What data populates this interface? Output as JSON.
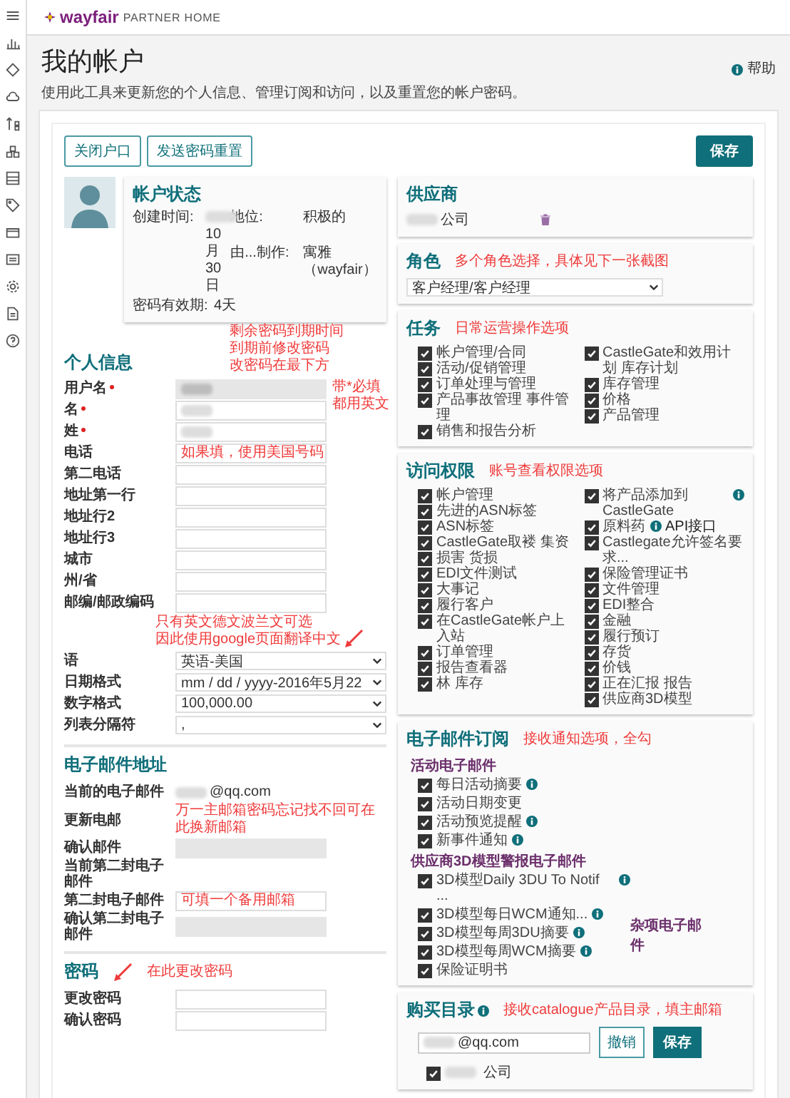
{
  "header": {
    "logo": "wayfair",
    "logo_sub": "PARTNER HOME"
  },
  "page": {
    "title": "我的帐户",
    "subtitle": "使用此工具来更新您的个人信息、管理订阅和访问，以及重置您的帐户密码。",
    "help": "帮助"
  },
  "actions": {
    "buttons": [
      "关闭户口",
      "发送密码重置"
    ],
    "save": "保存"
  },
  "account_status": {
    "title": "帐户状态",
    "fields_left": [
      {
        "label": "创建时间:",
        "value": "10月30日",
        "redacted": true
      }
    ],
    "fields_right": [
      {
        "label": "地位:",
        "value": "积极的",
        "redacted": false
      },
      {
        "label": "由...制作:",
        "value": "寓雅（wayfair）",
        "redacted": false
      }
    ],
    "expiry": {
      "label": "密码有效期:",
      "value": "4天"
    },
    "note": {
      "lines": [
        "剩余密码到期时间",
        "到期前修改密码",
        "改密码在最下方"
      ]
    }
  },
  "personal": {
    "title": "个人信息",
    "fields": [
      {
        "label": "用户名",
        "kind": "text",
        "required": true,
        "disabled": true,
        "redacted": true,
        "note": {
          "lines": [
            "带*必填",
            "都用英文"
          ],
          "kind": "side",
          "arrow": false
        }
      },
      {
        "label": "名",
        "kind": "text",
        "required": true,
        "disabled": false,
        "redacted": true
      },
      {
        "label": "姓",
        "kind": "text",
        "required": true,
        "disabled": false,
        "redacted": true
      },
      {
        "label": "电话",
        "kind": "text",
        "required": false,
        "disabled": false,
        "redacted": false,
        "note": {
          "lines": [
            "如果填，使用美国号码"
          ],
          "kind": "inside",
          "arrow": false
        }
      },
      {
        "label": "第二电话",
        "kind": "text",
        "required": false,
        "disabled": false,
        "redacted": false
      },
      {
        "label": "地址第一行",
        "kind": "text",
        "required": false,
        "disabled": false,
        "redacted": false
      },
      {
        "label": "地址行2",
        "kind": "text",
        "required": false,
        "disabled": false,
        "redacted": false
      },
      {
        "label": "地址行3",
        "kind": "text",
        "required": false,
        "disabled": false,
        "redacted": false
      },
      {
        "label": "城市",
        "kind": "text",
        "required": false,
        "disabled": false,
        "redacted": false
      },
      {
        "label": "州/省",
        "kind": "text",
        "required": false,
        "disabled": false,
        "redacted": false
      },
      {
        "label": "邮编/邮政编码",
        "kind": "text",
        "required": false,
        "disabled": false,
        "redacted": false,
        "note": {
          "lines": [
            "只有英文德文波兰文可选",
            "因此使用google页面翻译中文"
          ],
          "kind": "below",
          "arrow": true
        }
      },
      {
        "label": "语",
        "kind": "select",
        "value": "英语-美国",
        "required": false
      },
      {
        "label": "日期格式",
        "kind": "select",
        "value": "mm / dd / yyyy-2016年5月22",
        "required": false
      },
      {
        "label": "数字格式",
        "kind": "select",
        "value": "100,000.00",
        "required": false
      },
      {
        "label": "列表分隔符",
        "kind": "select",
        "value": ",",
        "required": false
      }
    ]
  },
  "email": {
    "title": "电子邮件地址",
    "fields": [
      {
        "label": "当前的电子邮件",
        "kind": "static",
        "value": "@qq.com",
        "required": false,
        "redacted": true
      },
      {
        "label": "更新电邮",
        "kind": "covered",
        "required": false,
        "note": {
          "lines": [
            "万一主邮箱密码忘记找不回可在此换新邮箱"
          ],
          "kind": "flow",
          "arrow": false
        }
      },
      {
        "label": "确认邮件",
        "kind": "text",
        "required": false,
        "disabled": true,
        "redacted": false
      },
      {
        "label": "当前第二封电子邮件",
        "kind": "static",
        "required": false,
        "redacted": false
      },
      {
        "label": "第二封电子邮件",
        "kind": "text",
        "required": false,
        "disabled": false,
        "redacted": false,
        "note": {
          "lines": [
            "可填一个备用邮箱"
          ],
          "kind": "inside",
          "arrow": false
        }
      },
      {
        "label": "确认第二封电子邮件",
        "kind": "text",
        "required": false,
        "disabled": true,
        "redacted": false
      }
    ]
  },
  "password": {
    "title": "密码",
    "note": {
      "lines": [
        "在此更改密码"
      ],
      "arrow": true
    },
    "fields": [
      {
        "label": "更改密码",
        "kind": "text",
        "required": false,
        "disabled": false,
        "redacted": false
      },
      {
        "label": "确认密码",
        "kind": "text",
        "required": false,
        "disabled": false,
        "redacted": false
      }
    ]
  },
  "supplier": {
    "title": "供应商",
    "company": "公司",
    "redacted": true
  },
  "role": {
    "title": "角色",
    "note": "多个角色选择，具体见下一张截图",
    "value": "客户经理/客户经理"
  },
  "tasks": {
    "title": "任务",
    "note": "日常运营操作选项",
    "columns": [
      [
        {
          "label": "帐户管理/合同",
          "checked": true,
          "info": false
        },
        {
          "label": "活动/促销管理",
          "checked": true,
          "info": false
        },
        {
          "label": "订单处理与管理",
          "checked": true,
          "info": false
        },
        {
          "label": "产品事故管理 事件管理",
          "checked": true,
          "info": false
        },
        {
          "label": "销售和报告分析",
          "checked": true,
          "info": false
        }
      ],
      [
        {
          "label": "CastleGate和效用计划 库存计划",
          "checked": true,
          "info": false
        },
        {
          "label": "库存管理",
          "checked": true,
          "info": false
        },
        {
          "label": "价格",
          "checked": true,
          "info": false
        },
        {
          "label": "产品管理",
          "checked": true,
          "info": false
        }
      ]
    ]
  },
  "access": {
    "title": "访问权限",
    "note": "账号查看权限选项",
    "columns": [
      [
        {
          "label": "帐户管理",
          "checked": true,
          "info": false
        },
        {
          "label": "先进的ASN标签",
          "checked": true,
          "info": false
        },
        {
          "label": "ASN标签",
          "checked": true,
          "info": false
        },
        {
          "label": "CastleGate取褛 集资",
          "checked": true,
          "info": false
        },
        {
          "label": "损害 货损",
          "checked": true,
          "info": false
        },
        {
          "label": "EDI文件测试",
          "checked": true,
          "info": false
        },
        {
          "label": "大事记",
          "checked": true,
          "info": false
        },
        {
          "label": "履行客户",
          "checked": true,
          "info": false
        },
        {
          "label": "在CastleGate帐户上入站",
          "checked": true,
          "info": false
        },
        {
          "label": "订单管理",
          "checked": true,
          "info": false
        },
        {
          "label": "报告查看器",
          "checked": true,
          "info": false
        },
        {
          "label": "林 库存",
          "checked": true,
          "info": false
        }
      ],
      [
        {
          "label": "将产品添加到CastleGate",
          "checked": true,
          "info": true
        },
        {
          "label": "原料药",
          "checked": true,
          "info": true,
          "extra": "API接口"
        },
        {
          "label": "Castlegate允许签名要求...",
          "checked": true,
          "info": false
        },
        {
          "label": "保险管理证书",
          "checked": true,
          "info": false
        },
        {
          "label": "文件管理",
          "checked": true,
          "info": false
        },
        {
          "label": "EDI整合",
          "checked": true,
          "info": false
        },
        {
          "label": "金融",
          "checked": true,
          "info": false
        },
        {
          "label": "履行预订",
          "checked": true,
          "info": false
        },
        {
          "label": "存货",
          "checked": true,
          "info": false
        },
        {
          "label": "价钱",
          "checked": true,
          "info": false
        },
        {
          "label": "正在汇报 报告",
          "checked": true,
          "info": false
        },
        {
          "label": "供应商3D模型",
          "checked": true,
          "info": false
        }
      ]
    ]
  },
  "subscriptions": {
    "title": "电子邮件订阅",
    "note": "接收通知选项，全勾",
    "groups": [
      {
        "title": "活动电子邮件",
        "items": [
          {
            "label": "每日活动摘要",
            "checked": true,
            "info": true
          },
          {
            "label": "活动日期变更",
            "checked": true,
            "info": false
          },
          {
            "label": "活动预览提醒",
            "checked": true,
            "info": true
          },
          {
            "label": "新事件通知",
            "checked": true,
            "info": true
          }
        ]
      },
      {
        "title": "供应商3D模型警报电子邮件",
        "side_heading": "杂项电子邮件",
        "items": [
          {
            "label": "3D模型Daily 3DU To Notif ...",
            "checked": true,
            "info": true
          },
          {
            "label": "3D模型每日WCM通知...",
            "checked": true,
            "info": true
          },
          {
            "label": "3D模型每周3DU摘要",
            "checked": true,
            "info": true
          },
          {
            "label": "3D模型每周WCM摘要",
            "checked": true,
            "info": true
          },
          {
            "label": "保险证明书",
            "checked": true,
            "info": false
          }
        ]
      }
    ]
  },
  "catalog": {
    "title": "购买目录",
    "info": true,
    "note": "接收catalogue产品目录，填主邮箱",
    "email": "@qq.com",
    "email_redacted": true,
    "button": "撤销",
    "save": "保存",
    "company": {
      "label": "公司",
      "checked": true,
      "redacted": true
    }
  }
}
